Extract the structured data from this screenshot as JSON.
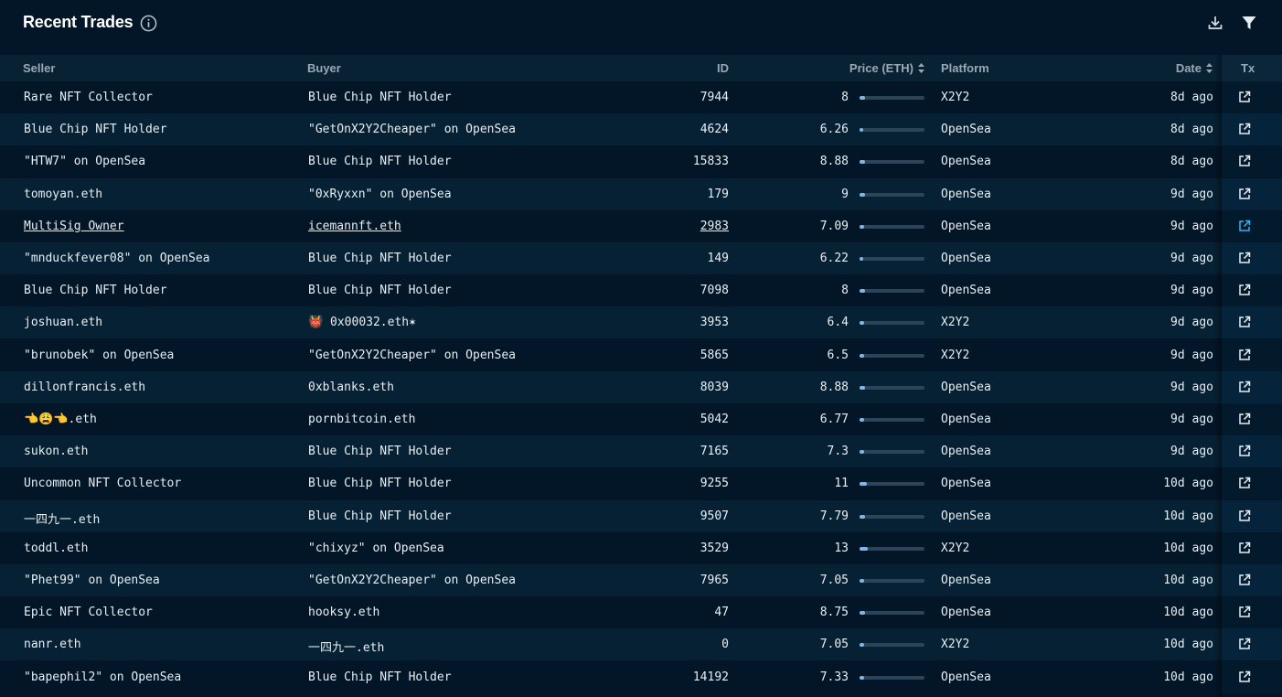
{
  "header": {
    "title": "Recent Trades"
  },
  "columns": {
    "seller": "Seller",
    "buyer": "Buyer",
    "id": "ID",
    "price": "Price (ETH)",
    "platform": "Platform",
    "date": "Date",
    "tx": "Tx"
  },
  "colors": {
    "background": "#021627",
    "row_alt": "#062133",
    "header_bg": "#082234",
    "bar_fill": "#7fb8e8",
    "link_active": "#29b6f6"
  },
  "price_max": 100,
  "rows": [
    {
      "seller": "Rare NFT Collector",
      "buyer": "Blue Chip NFT Holder",
      "id": "7944",
      "price": "8",
      "platform": "X2Y2",
      "date": "8d ago"
    },
    {
      "seller": "Blue Chip NFT Holder",
      "buyer": "\"GetOnX2Y2Cheaper\" on OpenSea",
      "id": "4624",
      "price": "6.26",
      "platform": "OpenSea",
      "date": "8d ago"
    },
    {
      "seller": "\"HTW7\" on OpenSea",
      "buyer": "Blue Chip NFT Holder",
      "id": "15833",
      "price": "8.88",
      "platform": "OpenSea",
      "date": "8d ago"
    },
    {
      "seller": "tomoyan.eth",
      "buyer": "\"0xRyxxn\" on OpenSea",
      "id": "179",
      "price": "9",
      "platform": "OpenSea",
      "date": "9d ago"
    },
    {
      "seller": "MultiSig Owner",
      "buyer": "icemannft.eth",
      "id": "2983",
      "price": "7.09",
      "platform": "OpenSea",
      "date": "9d ago",
      "hovered": true
    },
    {
      "seller": "\"mnduckfever08\" on OpenSea",
      "buyer": "Blue Chip NFT Holder",
      "id": "149",
      "price": "6.22",
      "platform": "OpenSea",
      "date": "9d ago"
    },
    {
      "seller": "Blue Chip NFT Holder",
      "buyer": "Blue Chip NFT Holder",
      "id": "7098",
      "price": "8",
      "platform": "OpenSea",
      "date": "9d ago"
    },
    {
      "seller": "joshuan.eth",
      "buyer": "👹 0x00032.eth✶",
      "id": "3953",
      "price": "6.4",
      "platform": "X2Y2",
      "date": "9d ago"
    },
    {
      "seller": "\"brunobek\" on OpenSea",
      "buyer": "\"GetOnX2Y2Cheaper\" on OpenSea",
      "id": "5865",
      "price": "6.5",
      "platform": "X2Y2",
      "date": "9d ago"
    },
    {
      "seller": "dillonfrancis.eth",
      "buyer": "0xblanks.eth",
      "id": "8039",
      "price": "8.88",
      "platform": "OpenSea",
      "date": "9d ago"
    },
    {
      "seller": "👈😩👈.eth",
      "buyer": "pornbitcoin.eth",
      "id": "5042",
      "price": "6.77",
      "platform": "OpenSea",
      "date": "9d ago"
    },
    {
      "seller": "sukon.eth",
      "buyer": "Blue Chip NFT Holder",
      "id": "7165",
      "price": "7.3",
      "platform": "OpenSea",
      "date": "9d ago"
    },
    {
      "seller": "Uncommon NFT Collector",
      "buyer": "Blue Chip NFT Holder",
      "id": "9255",
      "price": "11",
      "platform": "OpenSea",
      "date": "10d ago"
    },
    {
      "seller": "一四九一.eth",
      "buyer": "Blue Chip NFT Holder",
      "id": "9507",
      "price": "7.79",
      "platform": "OpenSea",
      "date": "10d ago"
    },
    {
      "seller": "toddl.eth",
      "buyer": "\"chixyz\" on OpenSea",
      "id": "3529",
      "price": "13",
      "platform": "X2Y2",
      "date": "10d ago"
    },
    {
      "seller": "\"Phet99\" on OpenSea",
      "buyer": "\"GetOnX2Y2Cheaper\" on OpenSea",
      "id": "7965",
      "price": "7.05",
      "platform": "OpenSea",
      "date": "10d ago"
    },
    {
      "seller": "Epic NFT Collector",
      "buyer": "hooksy.eth",
      "id": "47",
      "price": "8.75",
      "platform": "OpenSea",
      "date": "10d ago"
    },
    {
      "seller": "nanr.eth",
      "buyer": "一四九一.eth",
      "id": "0",
      "price": "7.05",
      "platform": "X2Y2",
      "date": "10d ago"
    },
    {
      "seller": "\"bapephil2\" on OpenSea",
      "buyer": "Blue Chip NFT Holder",
      "id": "14192",
      "price": "7.33",
      "platform": "OpenSea",
      "date": "10d ago"
    }
  ]
}
